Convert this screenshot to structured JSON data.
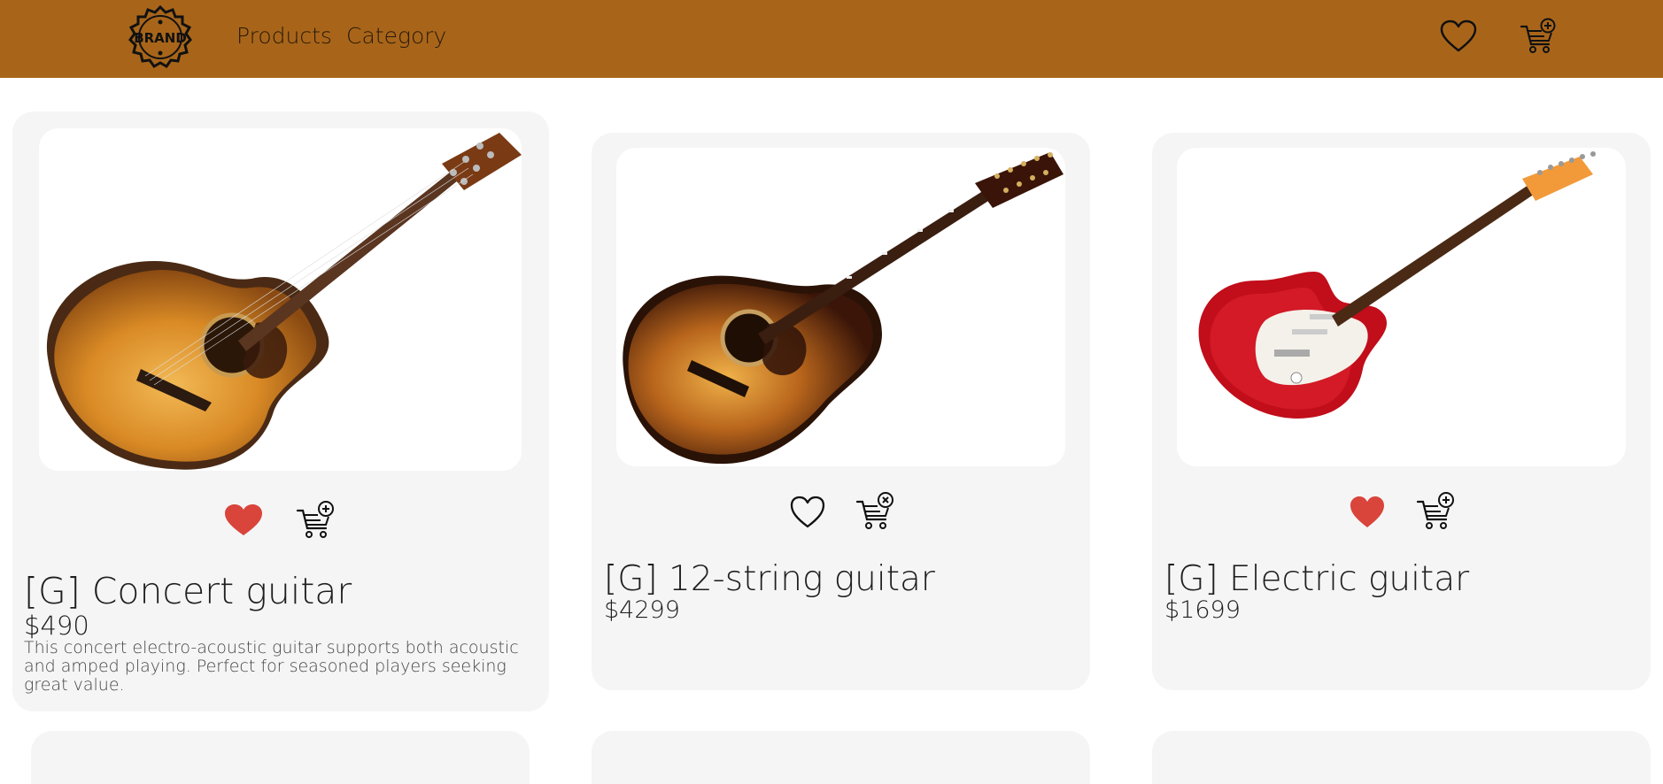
{
  "navbar": {
    "logo_text": "BRAND",
    "links": [
      {
        "label": "Products"
      },
      {
        "label": "Category"
      }
    ],
    "icons": [
      "heart-outline-icon",
      "cart-add-icon"
    ],
    "background": "#a8651a"
  },
  "products": [
    {
      "title": "[G] Concert guitar",
      "price": "$490",
      "description": "This concert electro-acoustic guitar supports both acoustic and amped playing. Perfect for seasoned players seeking great value.",
      "favorited": true,
      "cart_icon": "cart-add-icon"
    },
    {
      "title": "[G] 12-string guitar",
      "price": "$4299",
      "description": "",
      "favorited": false,
      "cart_icon": "cart-remove-icon"
    },
    {
      "title": "[G] Electric guitar",
      "price": "$1699",
      "description": "",
      "favorited": true,
      "cart_icon": "cart-add-icon"
    }
  ],
  "colors": {
    "favorite_red": "#d9443b",
    "card_bg": "#f5f5f5"
  }
}
